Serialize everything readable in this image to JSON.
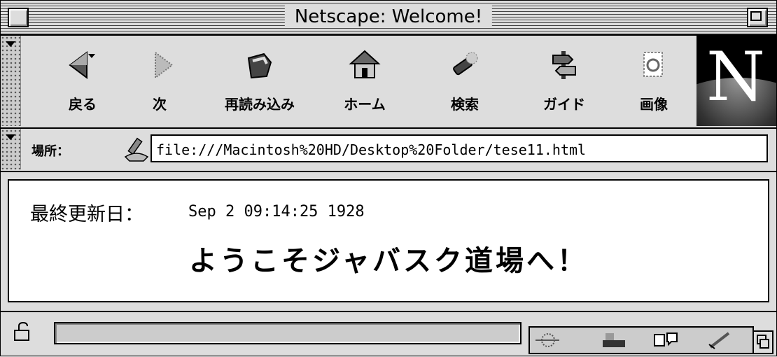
{
  "window": {
    "title": "Netscape: Welcome!"
  },
  "toolbar": {
    "buttons": [
      {
        "label": "戻る",
        "icon": "back-arrow-icon"
      },
      {
        "label": "次",
        "icon": "forward-arrow-icon"
      },
      {
        "label": "再読み込み",
        "icon": "reload-icon"
      },
      {
        "label": "ホーム",
        "icon": "home-icon"
      },
      {
        "label": "検索",
        "icon": "search-flashlight-icon"
      },
      {
        "label": "ガイド",
        "icon": "guide-signpost-icon"
      },
      {
        "label": "画像",
        "icon": "images-icon"
      }
    ],
    "logo": "N"
  },
  "location": {
    "label": "場所：",
    "url": "file:///Macintosh%20HD/Desktop%20Folder/tese11.html"
  },
  "content": {
    "last_modified_label": "最終更新日：",
    "last_modified_value": "Sep 2 09:14:25 1928",
    "welcome_heading": "ようこそジャバスク道場へ！"
  },
  "status": {
    "text": ""
  }
}
